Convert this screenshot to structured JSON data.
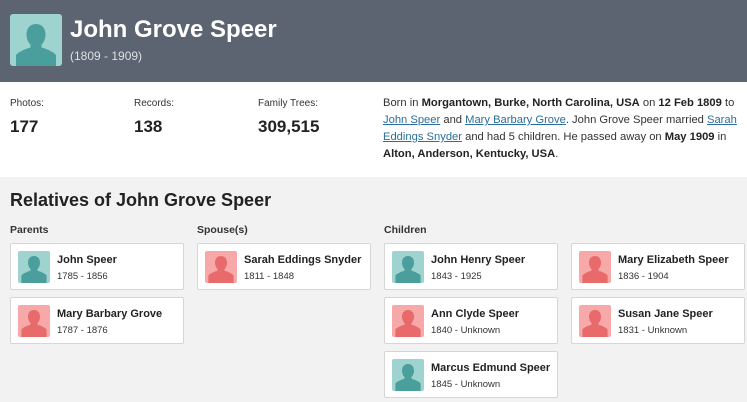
{
  "person": {
    "name": "John Grove Speer",
    "years": "(1809 - 1909)"
  },
  "stats": [
    {
      "label": "Photos:",
      "value": "177"
    },
    {
      "label": "Records:",
      "value": "138"
    },
    {
      "label": "Family Trees:",
      "value": "309,515"
    }
  ],
  "bio": {
    "t1": "Born in ",
    "birth_place": "Morgantown, Burke, North Carolina, USA",
    "t2": " on ",
    "birth_date": "12 Feb 1809",
    "t3": " to ",
    "father": "John Speer",
    "t4": " and ",
    "mother": "Mary Barbary Grove",
    "t5": ". John Grove Speer married ",
    "spouse": "Sarah Eddings Snyder",
    "t6": " and had 5 children. He passed away on ",
    "death_date": "May 1909",
    "t7": " in ",
    "death_place": "Alton, Anderson, Kentucky, USA",
    "t8": "."
  },
  "relatives": {
    "title": "Relatives of John Grove Speer",
    "parents_label": "Parents",
    "spouses_label": "Spouse(s)",
    "children_label": "Children",
    "parents": [
      {
        "name": "John Speer",
        "years": "1785 - 1856",
        "gender": "male"
      },
      {
        "name": "Mary Barbary Grove",
        "years": "1787 - 1876",
        "gender": "female"
      }
    ],
    "spouses": [
      {
        "name": "Sarah Eddings Snyder",
        "years": "1811 - 1848",
        "gender": "female"
      }
    ],
    "children": [
      {
        "name": "John Henry Speer",
        "years": "1843 - 1925",
        "gender": "male"
      },
      {
        "name": "Mary Elizabeth Speer",
        "years": "1836 - 1904",
        "gender": "female"
      },
      {
        "name": "Ann Clyde Speer",
        "years": "1840 - Unknown",
        "gender": "female"
      },
      {
        "name": "Susan Jane Speer",
        "years": "1831 - Unknown",
        "gender": "female"
      },
      {
        "name": "Marcus Edmund Speer",
        "years": "1845 - Unknown",
        "gender": "male"
      }
    ]
  },
  "colors": {
    "header_bg": "#5b6470",
    "male_avatar": "#9fd3d0",
    "female_avatar": "#f7a8a8",
    "link": "#2b6f9a",
    "section_bg": "#f2f2f2"
  }
}
